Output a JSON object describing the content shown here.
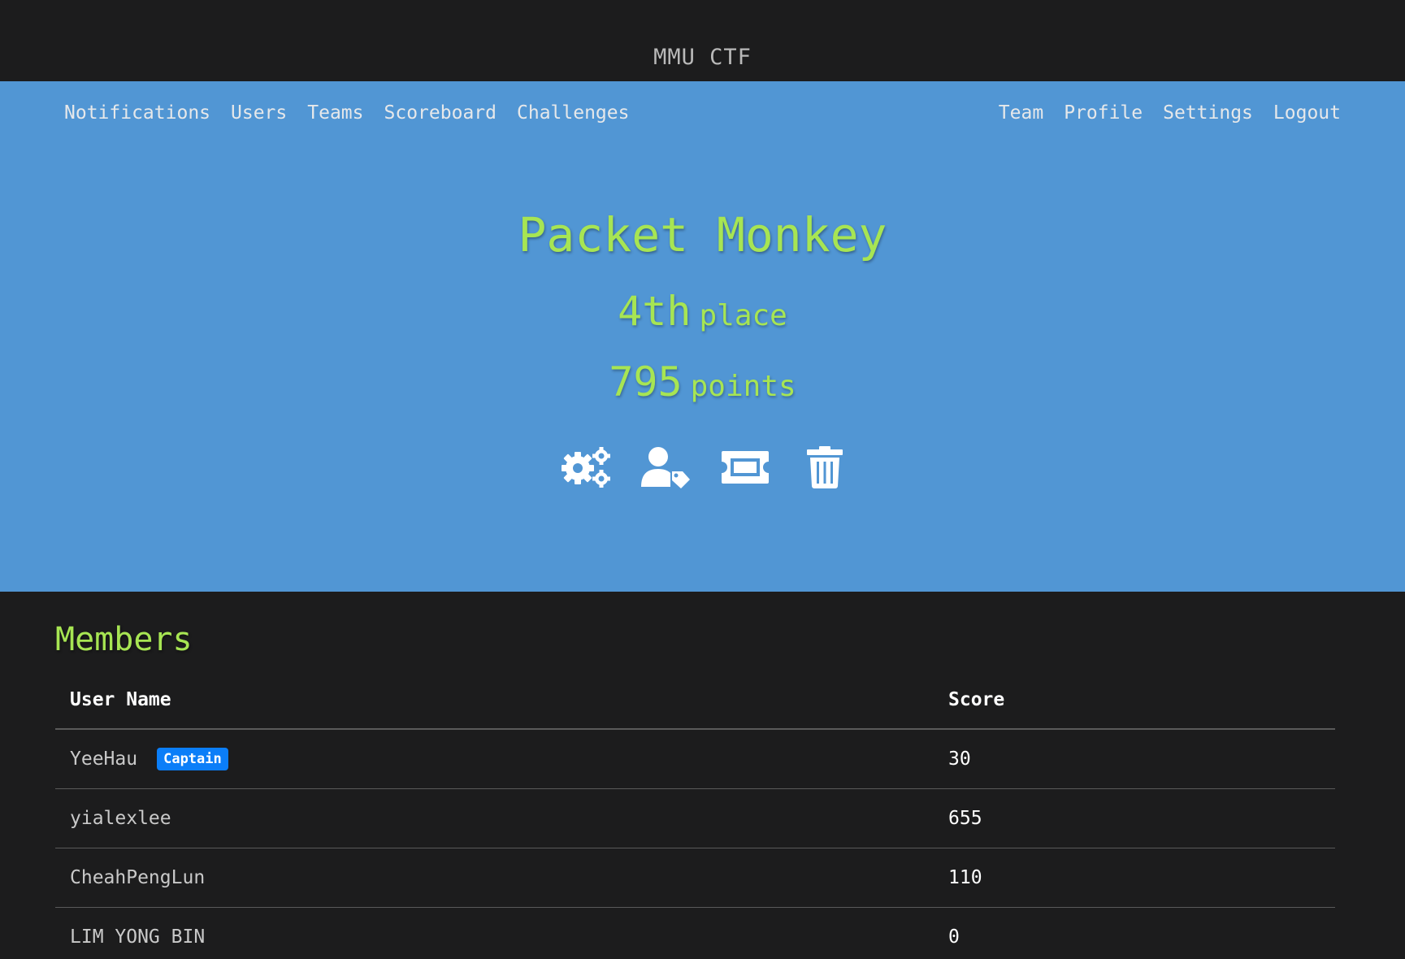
{
  "brand": "MMU CTF",
  "nav": {
    "left": [
      "Notifications",
      "Users",
      "Teams",
      "Scoreboard",
      "Challenges"
    ],
    "right": [
      "Team",
      "Profile",
      "Settings",
      "Logout"
    ]
  },
  "team": {
    "name": "Packet Monkey",
    "place_num": "4th",
    "place_unit": "place",
    "points_num": "795",
    "points_unit": "points"
  },
  "actions": [
    {
      "icon": "cogs-icon"
    },
    {
      "icon": "user-tag-icon"
    },
    {
      "icon": "ticket-icon"
    },
    {
      "icon": "trash-icon"
    }
  ],
  "members": {
    "title": "Members",
    "headers": {
      "user": "User Name",
      "score": "Score"
    },
    "rows": [
      {
        "name": "YeeHau",
        "badge": "Captain",
        "score": "30"
      },
      {
        "name": "yialexlee",
        "score": "655"
      },
      {
        "name": "CheahPengLun",
        "score": "110"
      },
      {
        "name": "LIM YONG BIN",
        "score": "0"
      }
    ]
  },
  "colors": {
    "background": "#1c1c1d",
    "hero": "#5196d4",
    "accent_green": "#a7e553",
    "badge_blue": "#0b7ef8"
  }
}
